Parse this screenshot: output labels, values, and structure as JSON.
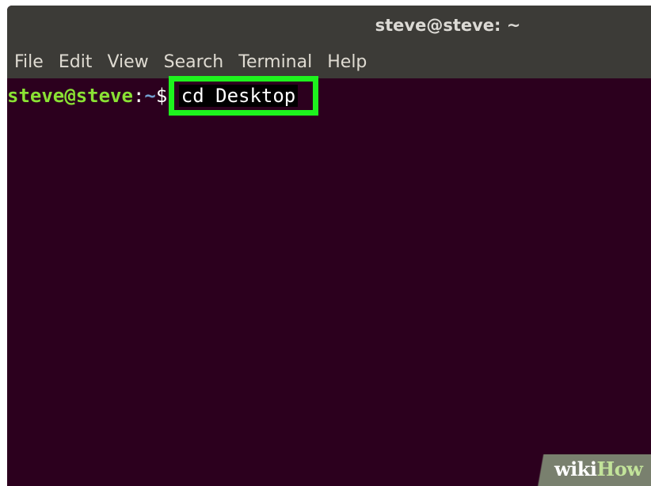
{
  "window": {
    "title": "steve@steve: ~"
  },
  "menubar": {
    "items": [
      {
        "label": "File"
      },
      {
        "label": "Edit"
      },
      {
        "label": "View"
      },
      {
        "label": "Search"
      },
      {
        "label": "Terminal"
      },
      {
        "label": "Help"
      }
    ]
  },
  "terminal": {
    "prompt_user": "steve@steve",
    "prompt_sep": ":",
    "prompt_path": "~",
    "prompt_symbol": "$",
    "command": "cd Desktop"
  },
  "watermark": {
    "wiki": "wiki",
    "how": "How"
  },
  "colors": {
    "terminal_bg": "#2c001e",
    "titlebar_bg": "#3c3b37",
    "prompt_user": "#8ae234",
    "prompt_path": "#729fcf",
    "highlight": "#1ef21e"
  }
}
